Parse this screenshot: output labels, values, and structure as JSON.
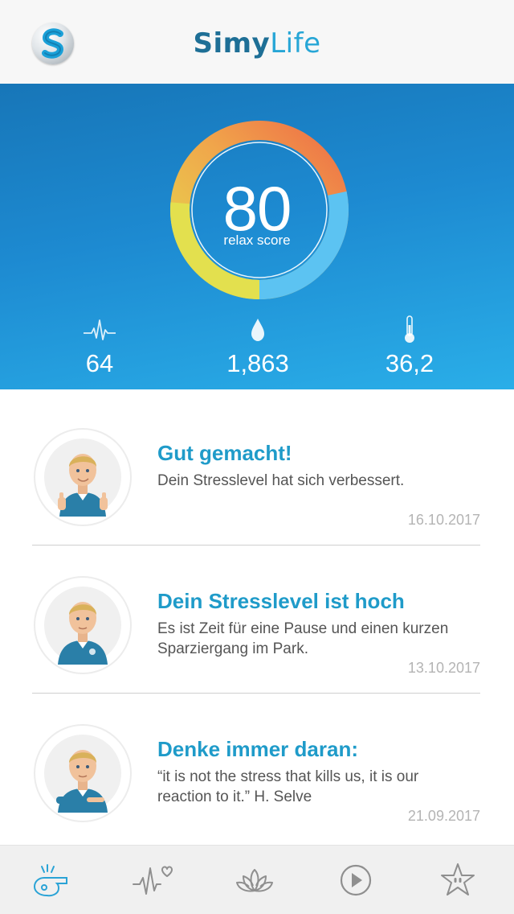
{
  "header": {
    "brand_simy": "Simy",
    "brand_life": "Life",
    "logo_icon": "simylife-logo-icon"
  },
  "hero": {
    "score": "80",
    "score_label": "relax score",
    "score_level": 0.8,
    "metrics": [
      {
        "icon": "heart-rate-icon",
        "value": "64"
      },
      {
        "icon": "drop-icon",
        "value": "1,863"
      },
      {
        "icon": "thermometer-icon",
        "value": "36,2"
      }
    ],
    "colors": {
      "gauge_yellow": "#e3df4f",
      "gauge_orange": "#f2a04a",
      "gauge_red": "#ee7a4a",
      "gauge_blue": "#5bc3f1",
      "background_top": "#1776b8",
      "background_bottom": "#2aaee8"
    }
  },
  "feed": [
    {
      "title": "Gut gemacht!",
      "text": "Dein Stresslevel hat sich verbessert.",
      "date": "16.10.2017",
      "avatar": "avatar-thumbs-up-icon"
    },
    {
      "title": "Dein Stresslevel ist hoch",
      "text": "Es ist Zeit für eine Pause und einen kurzen Sparziergang im Park.",
      "date": "13.10.2017",
      "avatar": "avatar-standing-icon"
    },
    {
      "title": "Denke immer daran:",
      "text": "“it is not the stress that kills us, it is our reaction to it.” H. Selve",
      "date": "21.09.2017",
      "avatar": "avatar-pointing-icon"
    }
  ],
  "tabbar": {
    "tabs": [
      {
        "icon": "whistle-icon",
        "active": true
      },
      {
        "icon": "heartbeat-icon",
        "active": false
      },
      {
        "icon": "lotus-icon",
        "active": false
      },
      {
        "icon": "play-icon",
        "active": false
      },
      {
        "icon": "star-icon",
        "active": false
      }
    ],
    "colors": {
      "active": "#2aa3d6",
      "inactive": "#8f8f8f"
    }
  }
}
